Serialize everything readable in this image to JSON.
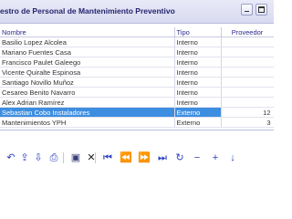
{
  "window": {
    "title": "estro de Personal de Mantenimiento Preventivo"
  },
  "table": {
    "columns": [
      "Nombre",
      "Tipo",
      "Proveedor"
    ],
    "rows": [
      {
        "nombre": "Basilio Lopez Alcolea",
        "tipo": "Interno",
        "proveedor": ""
      },
      {
        "nombre": "Mariano Fuentes Casa",
        "tipo": "Interno",
        "proveedor": ""
      },
      {
        "nombre": "Francisco Paulet Galeego",
        "tipo": "Interno",
        "proveedor": ""
      },
      {
        "nombre": "Vicente Quiralte Espinosa",
        "tipo": "Interno",
        "proveedor": ""
      },
      {
        "nombre": "Santiago Novillo Muñoz",
        "tipo": "Interno",
        "proveedor": ""
      },
      {
        "nombre": "Cesareo Benito Navarro",
        "tipo": "Interno",
        "proveedor": ""
      },
      {
        "nombre": "Alex Adrian Ramírez",
        "tipo": "Interno",
        "proveedor": ""
      },
      {
        "nombre": "Sebastian Cobo Instaladores",
        "tipo": "Externo",
        "proveedor": "12"
      },
      {
        "nombre": "Mantenimientos YPH",
        "tipo": "Externo",
        "proveedor": "3"
      }
    ],
    "selected_index": 7
  },
  "toolbar": {
    "buttons": [
      {
        "name": "undo-icon",
        "glyph": "↶",
        "color": "#2a3fbf"
      },
      {
        "name": "export-icon",
        "glyph": "⇪",
        "color": "#2a3fbf"
      },
      {
        "name": "import-icon",
        "glyph": "⇩",
        "color": "#2a3fbf"
      },
      {
        "name": "print-icon",
        "glyph": "⎙",
        "color": "#2a3fbf"
      },
      {
        "name": "save-icon",
        "glyph": "▣",
        "color": "#3a3f78"
      },
      {
        "name": "delete-icon",
        "glyph": "✕",
        "color": "#222222"
      },
      {
        "name": "first-record-icon",
        "glyph": "⏮",
        "color": "#2a3fbf"
      },
      {
        "name": "previous-page-icon",
        "glyph": "⏪",
        "color": "#2a3fbf"
      },
      {
        "name": "next-page-icon",
        "glyph": "⏩",
        "color": "#2a3fbf"
      },
      {
        "name": "last-record-icon",
        "glyph": "⏭",
        "color": "#2a3fbf"
      },
      {
        "name": "refresh-icon",
        "glyph": "↻",
        "color": "#2a3fbf"
      },
      {
        "name": "remove-icon",
        "glyph": "−",
        "color": "#2a3fbf"
      },
      {
        "name": "add-icon",
        "glyph": "+",
        "color": "#2a3fbf"
      },
      {
        "name": "move-down-icon",
        "glyph": "↓",
        "color": "#2a3fbf"
      }
    ]
  }
}
